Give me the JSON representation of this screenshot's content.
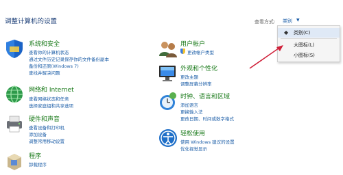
{
  "header": {
    "title": "调整计算机的设置",
    "view_by_label": "查看方式:",
    "view_by_value": "类别"
  },
  "view_menu": {
    "items": [
      {
        "label": "类别(C)",
        "selected": true
      },
      {
        "label": "大图标(L)",
        "selected": false
      },
      {
        "label": "小图标(S)",
        "selected": false
      }
    ]
  },
  "categories": {
    "system": {
      "title": "系统和安全",
      "links": [
        "查看你的计算机状态",
        "通过文件历史记录保存你的文件备份副本",
        "备份和还原(Windows 7)",
        "查找并解决问题"
      ]
    },
    "network": {
      "title": "网络和 Internet",
      "links": [
        "查看网络状态和任务",
        "选择家庭组和共享选项"
      ]
    },
    "hardware": {
      "title": "硬件和声音",
      "links": [
        "查看设备和打印机",
        "添加设备",
        "调整常用移动设置"
      ]
    },
    "programs": {
      "title": "程序",
      "links": [
        "卸载程序"
      ]
    },
    "accounts": {
      "title": "用户帐户",
      "links": [
        "更改帐户类型"
      ]
    },
    "appearance": {
      "title": "外观和个性化",
      "links": [
        "更改主题",
        "调整屏幕分辨率"
      ]
    },
    "clock": {
      "title": "时钟、语言和区域",
      "links": [
        "添加语言",
        "更换输入法",
        "更改日期、时间或数字格式"
      ]
    },
    "ease": {
      "title": "轻松使用",
      "links": [
        "使用 Windows 建议的设置",
        "优化视觉显示"
      ]
    }
  },
  "colors": {
    "link": "#1e5fa8",
    "category_title": "#1a7a1a",
    "annotation_arrow": "#d0213a"
  }
}
